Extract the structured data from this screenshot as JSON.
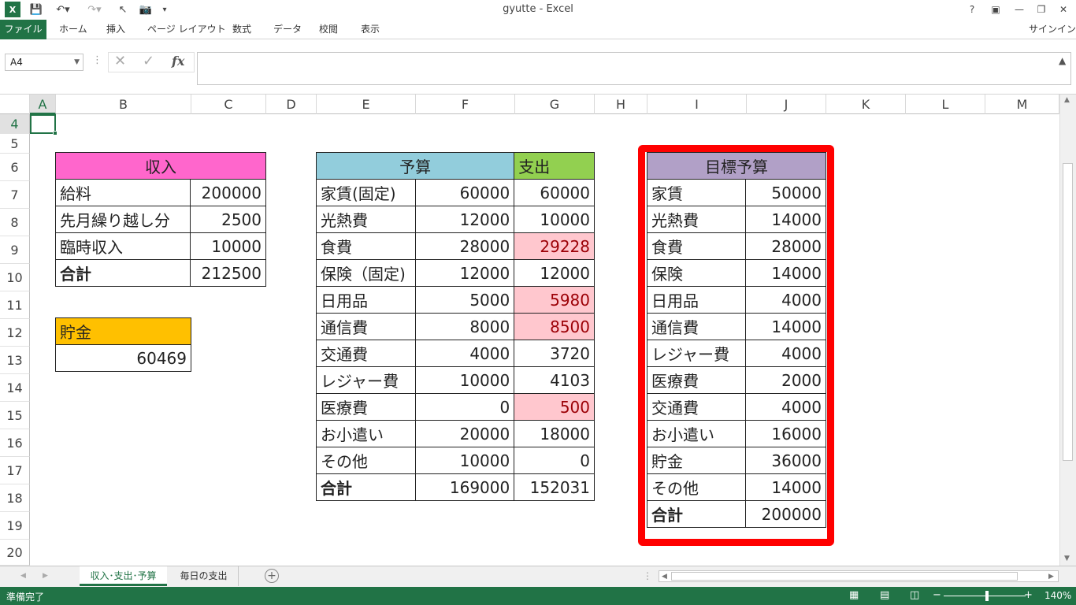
{
  "title": "gyutte - Excel",
  "ribbon": {
    "tabs": [
      "ファイル",
      "ホーム",
      "挿入",
      "ページ レイアウト",
      "数式",
      "データ",
      "校閲",
      "表示"
    ],
    "signin": "サインイン"
  },
  "formula": {
    "name_box": "A4",
    "fx": "fx"
  },
  "columns": [
    "A",
    "B",
    "C",
    "D",
    "E",
    "F",
    "G",
    "H",
    "I",
    "J",
    "K",
    "L",
    "M"
  ],
  "rows": [
    "4",
    "5",
    "6",
    "7",
    "8",
    "9",
    "10",
    "11",
    "12",
    "13",
    "14",
    "15",
    "16",
    "17",
    "18",
    "19",
    "20"
  ],
  "income": {
    "header": "収入",
    "rows": [
      {
        "label": "給料",
        "value": "200000"
      },
      {
        "label": "先月繰り越し分",
        "value": "2500"
      },
      {
        "label": "臨時収入",
        "value": "10000"
      },
      {
        "label": "合計",
        "value": "212500"
      }
    ]
  },
  "savings": {
    "header": "貯金",
    "value": "60469"
  },
  "budget": {
    "header_budget": "予算",
    "header_spent": "支出",
    "rows": [
      {
        "label": "家賃(固定)",
        "budget": "60000",
        "spent": "60000",
        "over": false
      },
      {
        "label": "光熱費",
        "budget": "12000",
        "spent": "10000",
        "over": false
      },
      {
        "label": "食費",
        "budget": "28000",
        "spent": "29228",
        "over": true
      },
      {
        "label": "保険（固定)",
        "budget": "12000",
        "spent": "12000",
        "over": false
      },
      {
        "label": "日用品",
        "budget": "5000",
        "spent": "5980",
        "over": true
      },
      {
        "label": "通信費",
        "budget": "8000",
        "spent": "8500",
        "over": true
      },
      {
        "label": "交通費",
        "budget": "4000",
        "spent": "3720",
        "over": false
      },
      {
        "label": "レジャー費",
        "budget": "10000",
        "spent": "4103",
        "over": false
      },
      {
        "label": "医療費",
        "budget": "0",
        "spent": "500",
        "over": true
      },
      {
        "label": "お小遣い",
        "budget": "20000",
        "spent": "18000",
        "over": false
      },
      {
        "label": "その他",
        "budget": "10000",
        "spent": "0",
        "over": false
      },
      {
        "label": "合計",
        "budget": "169000",
        "spent": "152031",
        "over": false
      }
    ]
  },
  "goal": {
    "header": "目標予算",
    "rows": [
      {
        "label": "家賃",
        "value": "50000"
      },
      {
        "label": "光熱費",
        "value": "14000"
      },
      {
        "label": "食費",
        "value": "28000"
      },
      {
        "label": "保険",
        "value": "14000"
      },
      {
        "label": "日用品",
        "value": "4000"
      },
      {
        "label": "通信費",
        "value": "14000"
      },
      {
        "label": "レジャー費",
        "value": "4000"
      },
      {
        "label": "医療費",
        "value": "2000"
      },
      {
        "label": "交通費",
        "value": "4000"
      },
      {
        "label": "お小遣い",
        "value": "16000"
      },
      {
        "label": "貯金",
        "value": "36000"
      },
      {
        "label": "その他",
        "value": "14000"
      },
      {
        "label": "合計",
        "value": "200000"
      }
    ]
  },
  "sheets": [
    "収入･支出･予算",
    "毎日の支出"
  ],
  "status": {
    "ready": "準備完了",
    "zoom": "140%"
  },
  "colors": {
    "excel_green": "#217346",
    "income_header": "#ff66cc",
    "savings_header": "#ffc000",
    "budget_header": "#92cddc",
    "spent_header": "#92d050",
    "goal_header": "#b1a0c7",
    "over_fill": "#ffc7ce",
    "over_text": "#9c0006",
    "highlight_frame": "#ff0000"
  }
}
